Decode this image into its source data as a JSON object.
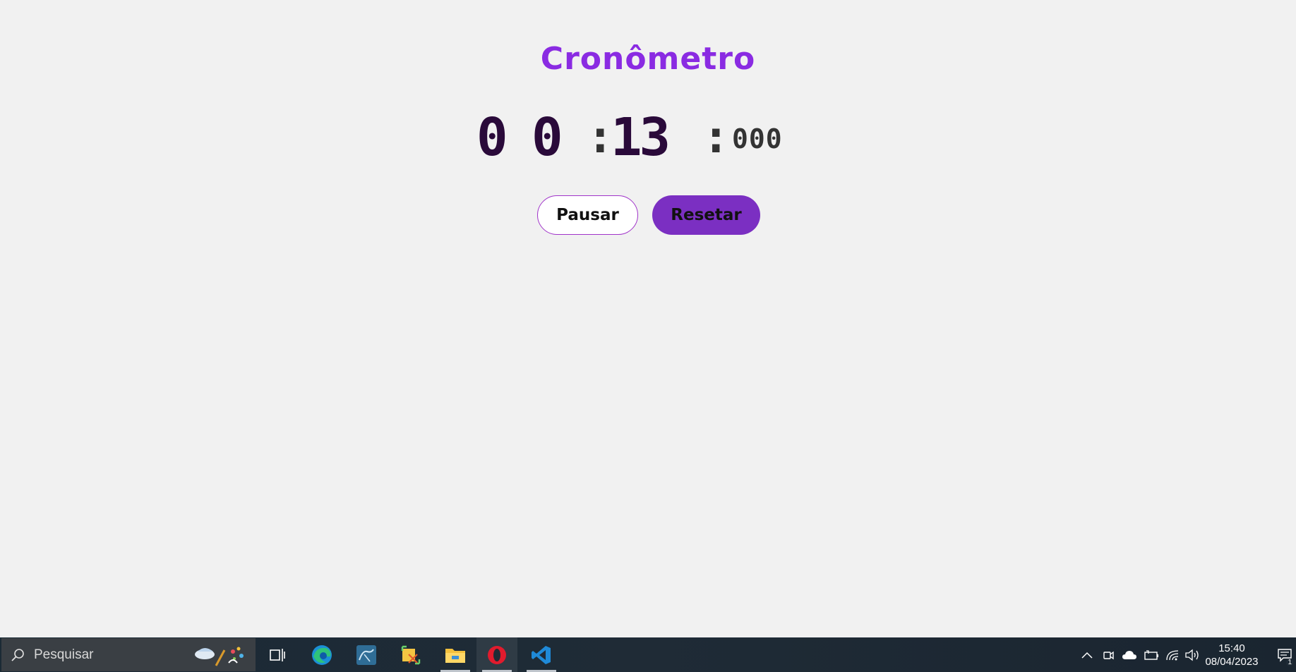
{
  "app": {
    "title": "Cronômetro",
    "display": {
      "minutes_tens": "0",
      "minutes_ones": "0",
      "separator_1": ":",
      "seconds": "13",
      "separator_2": ":",
      "milliseconds": "000"
    },
    "buttons": {
      "pause_label": "Pausar",
      "reset_label": "Resetar"
    },
    "colors": {
      "title": "#8a2be2",
      "digits": "#2a0a3a",
      "reset_bg": "#7b2fc2",
      "pause_border": "#a033c9"
    }
  },
  "taskbar": {
    "search_placeholder": "Pesquisar",
    "pinned_apps": [
      {
        "icon": "task-view-icon"
      },
      {
        "icon": "edge-icon"
      },
      {
        "icon": "mysql-workbench-icon"
      },
      {
        "icon": "snip-tool-icon"
      },
      {
        "icon": "file-explorer-icon"
      },
      {
        "icon": "opera-icon"
      },
      {
        "icon": "vscode-icon"
      }
    ],
    "tray_icons": [
      "chevron-up-icon",
      "meet-now-icon",
      "onedrive-icon",
      "battery-icon",
      "wifi-icon",
      "volume-icon"
    ],
    "clock": {
      "time": "15:40",
      "date": "08/04/2023"
    },
    "notifications_count": "1"
  }
}
